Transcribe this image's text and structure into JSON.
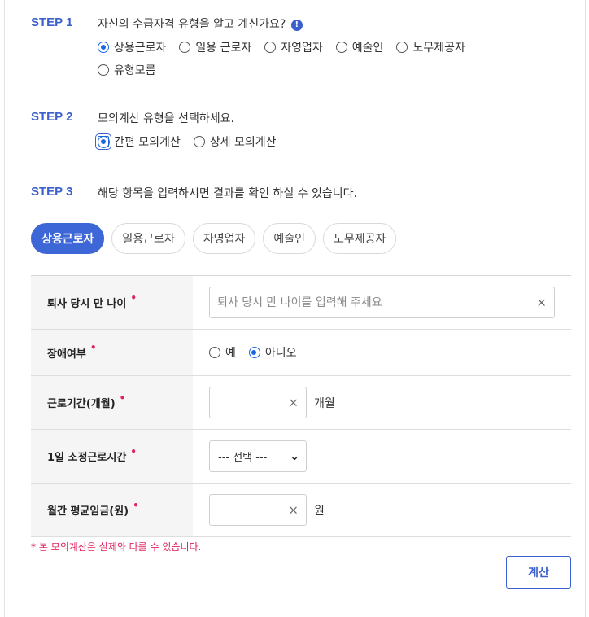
{
  "step1": {
    "label": "STEP 1",
    "question": "자신의 수급자격 유형을 알고 계신가요?",
    "info_icon": "!",
    "options": [
      "상용근로자",
      "일용 근로자",
      "자영업자",
      "예술인",
      "노무제공자",
      "유형모름"
    ],
    "selected": "상용근로자"
  },
  "step2": {
    "label": "STEP 2",
    "question": "모의계산 유형을 선택하세요.",
    "options": [
      "간편 모의계산",
      "상세 모의계산"
    ],
    "selected": "간편 모의계산"
  },
  "step3": {
    "label": "STEP 3",
    "description": "해당 항목을 입력하시면 결과를 확인 하실 수 있습니다."
  },
  "tabs": [
    "상용근로자",
    "일용근로자",
    "자영업자",
    "예술인",
    "노무제공자"
  ],
  "active_tab": "상용근로자",
  "form": {
    "required_mark": "•",
    "clear_icon": "×",
    "age": {
      "label": "퇴사 당시 만 나이",
      "placeholder": "퇴사 당시 만 나이를 입력해 주세요",
      "value": ""
    },
    "disability": {
      "label": "장애여부",
      "options": [
        "예",
        "아니오"
      ],
      "selected": "아니오"
    },
    "period": {
      "label": "근로기간(개월)",
      "value": "",
      "unit": "개월"
    },
    "hours": {
      "label": "1일 소정근로시간",
      "selected": "--- 선택 ---"
    },
    "wage": {
      "label": "월간 평균임금(원)",
      "value": "",
      "unit": "원"
    }
  },
  "note": "* 본 모의계산은 실제와 다를 수 있습니다.",
  "calculate_button": "계산",
  "colors": {
    "accent": "#3b5fcc",
    "tab_active": "#3d66d6",
    "required": "#e0245e",
    "radio_checked": "#1a66e0"
  }
}
